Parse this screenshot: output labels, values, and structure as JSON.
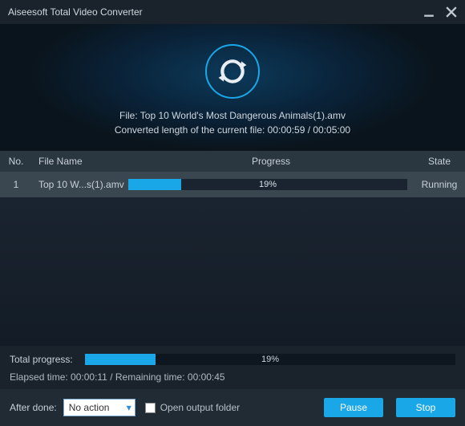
{
  "titlebar": {
    "title": "Aiseesoft Total Video Converter"
  },
  "hero": {
    "file_line": "File: Top 10 World's Most Dangerous Animals(1).amv",
    "length_line": "Converted length of the current file: 00:00:59 / 00:05:00"
  },
  "table": {
    "headers": {
      "no": "No.",
      "name": "File Name",
      "progress": "Progress",
      "state": "State"
    },
    "rows": [
      {
        "no": "1",
        "name": "Top 10 W...s(1).amv",
        "percent": "19%",
        "percent_css": "width:19%",
        "state": "Running"
      }
    ]
  },
  "summary": {
    "total_label": "Total progress:",
    "total_percent": "19%",
    "total_percent_css": "width:19%",
    "times": "Elapsed time: 00:00:11 / Remaining time: 00:00:45"
  },
  "footer": {
    "after_done_label": "After done:",
    "after_done_value": "No action",
    "open_output_label": "Open output folder",
    "pause": "Pause",
    "stop": "Stop"
  }
}
